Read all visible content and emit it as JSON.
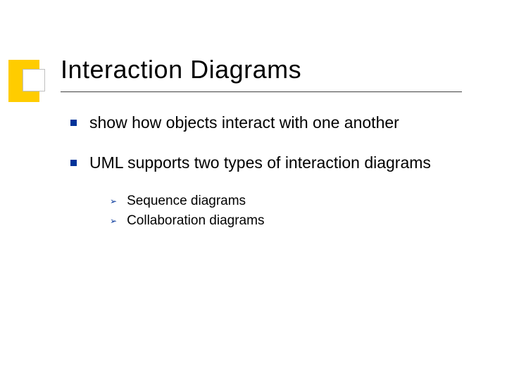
{
  "title": "Interaction Diagrams",
  "bullets": [
    {
      "text": "show how objects interact with one another"
    },
    {
      "text": "UML supports two types of interaction diagrams",
      "sub": [
        "Sequence diagrams",
        "Collaboration diagrams"
      ]
    }
  ]
}
